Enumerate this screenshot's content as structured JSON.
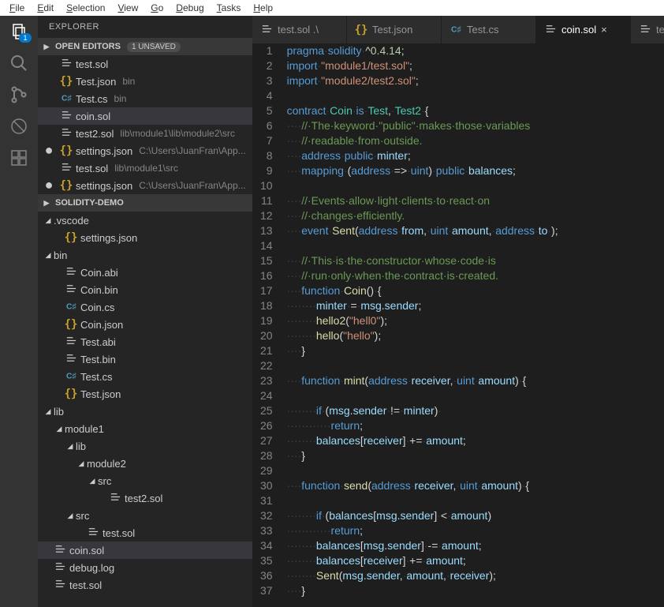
{
  "menubar": [
    "File",
    "Edit",
    "Selection",
    "View",
    "Go",
    "Debug",
    "Tasks",
    "Help"
  ],
  "activitybar": {
    "explorer_badge": "1"
  },
  "sidebar": {
    "title": "EXPLORER",
    "open_editors": {
      "label": "OPEN EDITORS",
      "unsaved_badge": "1 UNSAVED",
      "items": [
        {
          "icon": "sol",
          "name": "test.sol",
          "hint": "",
          "dirty": false
        },
        {
          "icon": "json",
          "name": "Test.json",
          "hint": "bin",
          "dirty": false
        },
        {
          "icon": "csharp",
          "name": "Test.cs",
          "hint": "bin",
          "dirty": false
        },
        {
          "icon": "sol",
          "name": "coin.sol",
          "hint": "",
          "dirty": false,
          "active": true
        },
        {
          "icon": "sol",
          "name": "test2.sol",
          "hint": "lib\\module1\\lib\\module2\\src",
          "dirty": false
        },
        {
          "icon": "json",
          "name": "settings.json",
          "hint": "C:\\Users\\JuanFran\\App...",
          "dirty": true
        },
        {
          "icon": "sol",
          "name": "test.sol",
          "hint": "lib\\module1\\src",
          "dirty": false
        },
        {
          "icon": "json",
          "name": "settings.json",
          "hint": "C:\\Users\\JuanFran\\App...",
          "dirty": true
        }
      ]
    },
    "project": {
      "label": "SOLIDITY-DEMO",
      "items": [
        {
          "depth": 0,
          "kind": "folder-open",
          "name": ".vscode"
        },
        {
          "depth": 1,
          "kind": "file",
          "icon": "json",
          "name": "settings.json"
        },
        {
          "depth": 0,
          "kind": "folder-open",
          "name": "bin"
        },
        {
          "depth": 1,
          "kind": "file",
          "icon": "generic",
          "name": "Coin.abi"
        },
        {
          "depth": 1,
          "kind": "file",
          "icon": "generic",
          "name": "Coin.bin"
        },
        {
          "depth": 1,
          "kind": "file",
          "icon": "csharp",
          "name": "Coin.cs"
        },
        {
          "depth": 1,
          "kind": "file",
          "icon": "json",
          "name": "Coin.json"
        },
        {
          "depth": 1,
          "kind": "file",
          "icon": "generic",
          "name": "Test.abi"
        },
        {
          "depth": 1,
          "kind": "file",
          "icon": "generic",
          "name": "Test.bin"
        },
        {
          "depth": 1,
          "kind": "file",
          "icon": "csharp",
          "name": "Test.cs"
        },
        {
          "depth": 1,
          "kind": "file",
          "icon": "json",
          "name": "Test.json"
        },
        {
          "depth": 0,
          "kind": "folder-open",
          "name": "lib"
        },
        {
          "depth": 1,
          "kind": "folder-open",
          "name": "module1"
        },
        {
          "depth": 2,
          "kind": "folder-open",
          "name": "lib"
        },
        {
          "depth": 3,
          "kind": "folder-open",
          "name": "module2"
        },
        {
          "depth": 4,
          "kind": "folder-open",
          "name": "src"
        },
        {
          "depth": 5,
          "kind": "file",
          "icon": "sol",
          "name": "test2.sol"
        },
        {
          "depth": 2,
          "kind": "folder-open",
          "name": "src"
        },
        {
          "depth": 3,
          "kind": "file",
          "icon": "sol",
          "name": "test.sol"
        },
        {
          "depth": 0,
          "kind": "file",
          "icon": "sol",
          "name": "coin.sol",
          "active": true
        },
        {
          "depth": 0,
          "kind": "file",
          "icon": "generic",
          "name": "debug.log"
        },
        {
          "depth": 0,
          "kind": "file",
          "icon": "sol",
          "name": "test.sol"
        }
      ]
    }
  },
  "tabs": [
    {
      "icon": "sol",
      "label": "test.sol .\\"
    },
    {
      "icon": "json",
      "label": "Test.json"
    },
    {
      "icon": "csharp",
      "label": "Test.cs"
    },
    {
      "icon": "sol",
      "label": "coin.sol",
      "active": true,
      "close": true
    },
    {
      "icon": "sol",
      "label": "tes"
    }
  ],
  "code": {
    "lines": [
      [
        [
          "kw",
          "pragma"
        ],
        [
          "ws",
          "·"
        ],
        [
          "kw",
          "solidity"
        ],
        [
          "ws",
          "·"
        ],
        [
          "pl",
          "^"
        ],
        [
          "num",
          "0.4.14"
        ],
        [
          "pl",
          ";"
        ]
      ],
      [
        [
          "kw",
          "import"
        ],
        [
          "ws",
          "·"
        ],
        [
          "str",
          "\"module1/test.sol\""
        ],
        [
          "pl",
          ";"
        ]
      ],
      [
        [
          "kw",
          "import"
        ],
        [
          "ws",
          "·"
        ],
        [
          "str",
          "\"module2/test2.sol\""
        ],
        [
          "pl",
          ";"
        ]
      ],
      [],
      [
        [
          "kw",
          "contract"
        ],
        [
          "ws",
          "·"
        ],
        [
          "ty",
          "Coin"
        ],
        [
          "ws",
          "·"
        ],
        [
          "kw",
          "is"
        ],
        [
          "ws",
          "·"
        ],
        [
          "ty",
          "Test"
        ],
        [
          "pl",
          ","
        ],
        [
          "ws",
          "·"
        ],
        [
          "ty",
          "Test2"
        ],
        [
          "ws",
          "·"
        ],
        [
          "pl",
          "{"
        ]
      ],
      [
        [
          "ws",
          "····"
        ],
        [
          "cm",
          "//·The·keyword·\"public\"·makes·those·variables"
        ]
      ],
      [
        [
          "ws",
          "····"
        ],
        [
          "cm",
          "//·readable·from·outside."
        ]
      ],
      [
        [
          "ws",
          "····"
        ],
        [
          "kw",
          "address"
        ],
        [
          "ws",
          "·"
        ],
        [
          "kw",
          "public"
        ],
        [
          "ws",
          "·"
        ],
        [
          "vr",
          "minter"
        ],
        [
          "pl",
          ";"
        ]
      ],
      [
        [
          "ws",
          "····"
        ],
        [
          "kw",
          "mapping"
        ],
        [
          "ws",
          "·"
        ],
        [
          "pl",
          "("
        ],
        [
          "kw",
          "address"
        ],
        [
          "ws",
          "·"
        ],
        [
          "pl",
          "=>"
        ],
        [
          "ws",
          "·"
        ],
        [
          "kw",
          "uint"
        ],
        [
          "pl",
          ")"
        ],
        [
          "ws",
          "·"
        ],
        [
          "kw",
          "public"
        ],
        [
          "ws",
          "·"
        ],
        [
          "vr",
          "balances"
        ],
        [
          "pl",
          ";"
        ]
      ],
      [],
      [
        [
          "ws",
          "····"
        ],
        [
          "cm",
          "//·Events·allow·light·clients·to·react·on"
        ]
      ],
      [
        [
          "ws",
          "····"
        ],
        [
          "cm",
          "//·changes·efficiently."
        ]
      ],
      [
        [
          "ws",
          "····"
        ],
        [
          "kw",
          "event"
        ],
        [
          "ws",
          "·"
        ],
        [
          "fn",
          "Sent"
        ],
        [
          "pl",
          "("
        ],
        [
          "kw",
          "address"
        ],
        [
          "ws",
          "·"
        ],
        [
          "vr",
          "from"
        ],
        [
          "pl",
          ","
        ],
        [
          "ws",
          "·"
        ],
        [
          "kw",
          "uint"
        ],
        [
          "ws",
          "·"
        ],
        [
          "vr",
          "amount"
        ],
        [
          "pl",
          ","
        ],
        [
          "ws",
          "·"
        ],
        [
          "kw",
          "address"
        ],
        [
          "ws",
          "·"
        ],
        [
          "vr",
          "to"
        ],
        [
          "ws",
          "·"
        ],
        [
          "pl",
          ");"
        ]
      ],
      [],
      [
        [
          "ws",
          "····"
        ],
        [
          "cm",
          "//·This·is·the·constructor·whose·code·is"
        ]
      ],
      [
        [
          "ws",
          "····"
        ],
        [
          "cm",
          "//·run·only·when·the·contract·is·created."
        ]
      ],
      [
        [
          "ws",
          "····"
        ],
        [
          "kw",
          "function"
        ],
        [
          "ws",
          "·"
        ],
        [
          "fn",
          "Coin"
        ],
        [
          "pl",
          "()"
        ],
        [
          "ws",
          "·"
        ],
        [
          "pl",
          "{"
        ]
      ],
      [
        [
          "ws",
          "········"
        ],
        [
          "vr",
          "minter"
        ],
        [
          "ws",
          "·"
        ],
        [
          "pl",
          "="
        ],
        [
          "ws",
          "·"
        ],
        [
          "vr",
          "msg"
        ],
        [
          "pl",
          "."
        ],
        [
          "vr",
          "sender"
        ],
        [
          "pl",
          ";"
        ]
      ],
      [
        [
          "ws",
          "········"
        ],
        [
          "fn",
          "hello2"
        ],
        [
          "pl",
          "("
        ],
        [
          "str",
          "\"hell0\""
        ],
        [
          "pl",
          ");"
        ]
      ],
      [
        [
          "ws",
          "········"
        ],
        [
          "fn",
          "hello"
        ],
        [
          "pl",
          "("
        ],
        [
          "str",
          "\"hello\""
        ],
        [
          "pl",
          ");"
        ]
      ],
      [
        [
          "ws",
          "····"
        ],
        [
          "pl",
          "}"
        ]
      ],
      [],
      [
        [
          "ws",
          "····"
        ],
        [
          "kw",
          "function"
        ],
        [
          "ws",
          "·"
        ],
        [
          "fn",
          "mint"
        ],
        [
          "pl",
          "("
        ],
        [
          "kw",
          "address"
        ],
        [
          "ws",
          "·"
        ],
        [
          "vr",
          "receiver"
        ],
        [
          "pl",
          ","
        ],
        [
          "ws",
          "·"
        ],
        [
          "kw",
          "uint"
        ],
        [
          "ws",
          "·"
        ],
        [
          "vr",
          "amount"
        ],
        [
          "pl",
          ")"
        ],
        [
          "ws",
          "·"
        ],
        [
          "pl",
          "{"
        ]
      ],
      [],
      [
        [
          "ws",
          "········"
        ],
        [
          "kw",
          "if"
        ],
        [
          "ws",
          "·"
        ],
        [
          "pl",
          "("
        ],
        [
          "vr",
          "msg"
        ],
        [
          "pl",
          "."
        ],
        [
          "vr",
          "sender"
        ],
        [
          "ws",
          "·"
        ],
        [
          "pl",
          "!="
        ],
        [
          "ws",
          "·"
        ],
        [
          "vr",
          "minter"
        ],
        [
          "pl",
          ")"
        ],
        [
          "ws",
          "·"
        ]
      ],
      [
        [
          "ws",
          "············"
        ],
        [
          "kw",
          "return"
        ],
        [
          "pl",
          ";"
        ]
      ],
      [
        [
          "ws",
          "········"
        ],
        [
          "vr",
          "balances"
        ],
        [
          "pl",
          "["
        ],
        [
          "vr",
          "receiver"
        ],
        [
          "pl",
          "]"
        ],
        [
          "ws",
          "·"
        ],
        [
          "pl",
          "+="
        ],
        [
          "ws",
          "·"
        ],
        [
          "vr",
          "amount"
        ],
        [
          "pl",
          ";"
        ]
      ],
      [
        [
          "ws",
          "····"
        ],
        [
          "pl",
          "}"
        ]
      ],
      [],
      [
        [
          "ws",
          "····"
        ],
        [
          "kw",
          "function"
        ],
        [
          "ws",
          "·"
        ],
        [
          "fn",
          "send"
        ],
        [
          "pl",
          "("
        ],
        [
          "kw",
          "address"
        ],
        [
          "ws",
          "·"
        ],
        [
          "vr",
          "receiver"
        ],
        [
          "pl",
          ","
        ],
        [
          "ws",
          "·"
        ],
        [
          "kw",
          "uint"
        ],
        [
          "ws",
          "·"
        ],
        [
          "vr",
          "amount"
        ],
        [
          "pl",
          ")"
        ],
        [
          "ws",
          "·"
        ],
        [
          "pl",
          "{"
        ]
      ],
      [],
      [
        [
          "ws",
          "········"
        ],
        [
          "kw",
          "if"
        ],
        [
          "ws",
          "·"
        ],
        [
          "pl",
          "("
        ],
        [
          "vr",
          "balances"
        ],
        [
          "pl",
          "["
        ],
        [
          "vr",
          "msg"
        ],
        [
          "pl",
          "."
        ],
        [
          "vr",
          "sender"
        ],
        [
          "pl",
          "]"
        ],
        [
          "ws",
          "·"
        ],
        [
          "pl",
          "<"
        ],
        [
          "ws",
          "·"
        ],
        [
          "vr",
          "amount"
        ],
        [
          "pl",
          ")"
        ]
      ],
      [
        [
          "ws",
          "············"
        ],
        [
          "kw",
          "return"
        ],
        [
          "pl",
          ";"
        ]
      ],
      [
        [
          "ws",
          "········"
        ],
        [
          "vr",
          "balances"
        ],
        [
          "pl",
          "["
        ],
        [
          "vr",
          "msg"
        ],
        [
          "pl",
          "."
        ],
        [
          "vr",
          "sender"
        ],
        [
          "pl",
          "]"
        ],
        [
          "ws",
          "·"
        ],
        [
          "pl",
          "-="
        ],
        [
          "ws",
          "·"
        ],
        [
          "vr",
          "amount"
        ],
        [
          "pl",
          ";"
        ]
      ],
      [
        [
          "ws",
          "········"
        ],
        [
          "vr",
          "balances"
        ],
        [
          "pl",
          "["
        ],
        [
          "vr",
          "receiver"
        ],
        [
          "pl",
          "]"
        ],
        [
          "ws",
          "·"
        ],
        [
          "pl",
          "+="
        ],
        [
          "ws",
          "·"
        ],
        [
          "vr",
          "amount"
        ],
        [
          "pl",
          ";"
        ]
      ],
      [
        [
          "ws",
          "········"
        ],
        [
          "fn",
          "Sent"
        ],
        [
          "pl",
          "("
        ],
        [
          "vr",
          "msg"
        ],
        [
          "pl",
          "."
        ],
        [
          "vr",
          "sender"
        ],
        [
          "pl",
          ","
        ],
        [
          "ws",
          "·"
        ],
        [
          "vr",
          "amount"
        ],
        [
          "pl",
          ","
        ],
        [
          "ws",
          "·"
        ],
        [
          "vr",
          "receiver"
        ],
        [
          "pl",
          ");"
        ]
      ],
      [
        [
          "ws",
          "····"
        ],
        [
          "pl",
          "}"
        ]
      ]
    ]
  }
}
